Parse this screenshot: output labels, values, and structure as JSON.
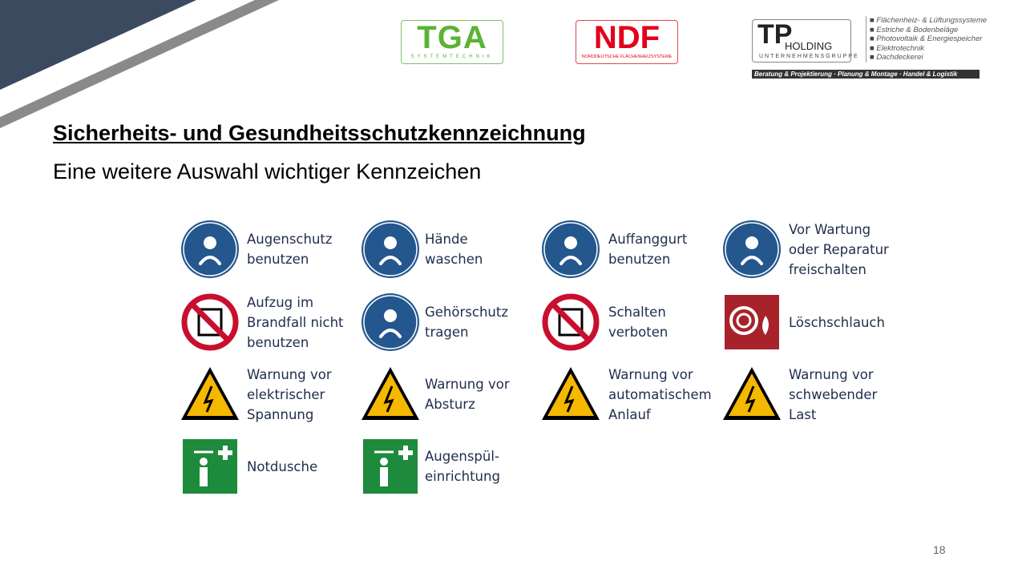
{
  "logos": {
    "tga": {
      "name": "TGA",
      "sub": "SYSTEMTECHNIK",
      "color": "#5bb234"
    },
    "ndf": {
      "name": "NDF",
      "sub": "NORDDEUTSCHE FLÄCHENHEIZSYSTEME",
      "color": "#e3001b"
    },
    "tp": {
      "name": "TP",
      "holding": "HOLDING",
      "sub": "UNTERNEHMENSGRUPPE",
      "services": [
        "Flächenheiz- & Lüftungssysteme",
        "Estriche & Bodenbeläge",
        "Photovoltaik & Energiespeicher",
        "Elektrotechnik",
        "Dachdeckerei"
      ],
      "tagline": "Beratung & Projektierung · Planung & Montage · Handel & Logistik"
    }
  },
  "title": "Sicherheits- und Gesundheitsschutzkennzeichnung",
  "subtitle": "Eine weitere Auswahl wichtiger Kennzeichen",
  "signs": [
    {
      "label": "Augenschutz\nbenutzen",
      "type": "mandatory",
      "icon": "goggles-icon"
    },
    {
      "label": "Hände\nwaschen",
      "type": "mandatory",
      "icon": "wash-hands-icon"
    },
    {
      "label": "Auffanggurt\nbenutzen",
      "type": "mandatory",
      "icon": "harness-icon"
    },
    {
      "label": "Vor Wartung\noder Reparatur\nfreischalten",
      "type": "mandatory",
      "icon": "disconnect-switch-icon"
    },
    {
      "label": "Aufzug im\nBrandfall nicht\nbenutzen",
      "type": "prohibition",
      "icon": "no-elevator-icon"
    },
    {
      "label": "Gehörschutz\ntragen",
      "type": "mandatory",
      "icon": "ear-protection-icon"
    },
    {
      "label": "Schalten\nverboten",
      "type": "prohibition",
      "icon": "no-switching-icon"
    },
    {
      "label": "Löschschlauch",
      "type": "fire",
      "icon": "fire-hose-icon"
    },
    {
      "label": "Warnung vor\nelektrischer\nSpannung",
      "type": "warning",
      "icon": "electric-voltage-icon"
    },
    {
      "label": "Warnung vor\nAbsturz",
      "type": "warning",
      "icon": "fall-hazard-icon"
    },
    {
      "label": "Warnung vor\nautomatischem\nAnlauf",
      "type": "warning",
      "icon": "automatic-start-icon"
    },
    {
      "label": "Warnung vor\nschwebender\nLast",
      "type": "warning",
      "icon": "suspended-load-icon"
    },
    {
      "label": "Notdusche",
      "type": "rescue",
      "icon": "emergency-shower-icon"
    },
    {
      "label": "Augenspül-\neinrichtung",
      "type": "rescue",
      "icon": "eyewash-icon"
    }
  ],
  "colors": {
    "mandatory": "#24578e",
    "prohibition": "#c8102e",
    "warning": "#f5b800",
    "fire": "#a8222a",
    "rescue": "#1d8a3c",
    "accent_dark": "#3c4a60",
    "accent_gray": "#8a8a8a"
  },
  "page_number": "18"
}
